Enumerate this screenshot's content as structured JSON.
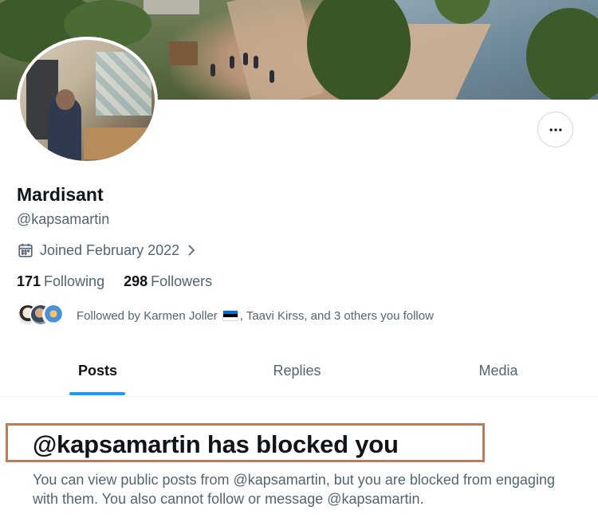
{
  "profile": {
    "display_name": "Mardisant",
    "handle": "@kapsamartin",
    "joined": "Joined February 2022",
    "following_count": "171",
    "following_label": "Following",
    "followers_count": "298",
    "followers_label": "Followers",
    "followed_by_prefix": "Followed by Karmen Joller",
    "followed_by_suffix": ", Taavi Kirss, and 3 others you follow"
  },
  "icons": {
    "more": "more-horizontal-icon",
    "calendar": "calendar-icon",
    "chevron": "chevron-right-icon",
    "flag": "estonia-flag-icon"
  },
  "tabs": [
    {
      "label": "Posts",
      "active": true
    },
    {
      "label": "Replies",
      "active": false
    },
    {
      "label": "Media",
      "active": false
    }
  ],
  "blocked": {
    "title": "@kapsamartin has blocked you",
    "message": "You can view public posts from @kapsamartin, but you are blocked from engaging with them. You also cannot follow or message @kapsamartin."
  },
  "colors": {
    "accent": "#1d9bf0",
    "text_primary": "#0f1419",
    "text_secondary": "#536471",
    "highlight_box": "#b97d5a"
  }
}
